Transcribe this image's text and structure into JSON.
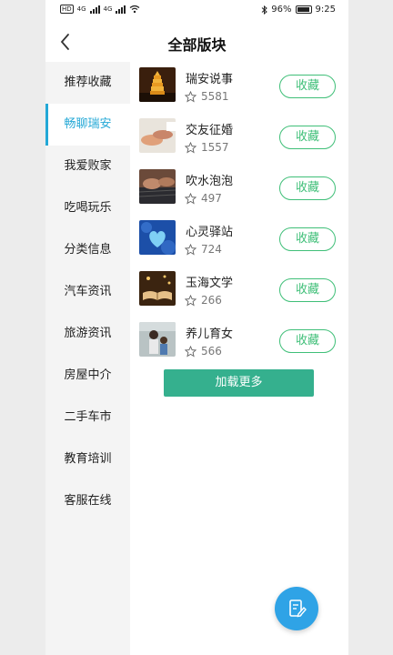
{
  "status": {
    "sim": "HD",
    "net1": "4G",
    "net2": "4G",
    "battery": "96%",
    "time": "9:25"
  },
  "header": {
    "title": "全部版块"
  },
  "sidebar": {
    "items": [
      {
        "label": "推荐收藏"
      },
      {
        "label": "畅聊瑞安",
        "active": true
      },
      {
        "label": "我爱败家"
      },
      {
        "label": "吃喝玩乐"
      },
      {
        "label": "分类信息"
      },
      {
        "label": "汽车资讯"
      },
      {
        "label": "旅游资讯"
      },
      {
        "label": "房屋中介"
      },
      {
        "label": "二手车市"
      },
      {
        "label": "教育培训"
      },
      {
        "label": "客服在线"
      }
    ]
  },
  "boards": [
    {
      "name": "瑞安说事",
      "count": "5581",
      "button": "收藏",
      "thumb": "pagoda-night"
    },
    {
      "name": "交友征婚",
      "count": "1557",
      "button": "收藏",
      "thumb": "hands"
    },
    {
      "name": "吹水泡泡",
      "count": "497",
      "button": "收藏",
      "thumb": "keyboard"
    },
    {
      "name": "心灵驿站",
      "count": "724",
      "button": "收藏",
      "thumb": "blue-heart"
    },
    {
      "name": "玉海文学",
      "count": "266",
      "button": "收藏",
      "thumb": "open-book"
    },
    {
      "name": "养儿育女",
      "count": "566",
      "button": "收藏",
      "thumb": "parent-child"
    }
  ],
  "load_more": "加载更多",
  "colors": {
    "accent_blue": "#23a8d6",
    "green": "#3fbf78",
    "load_more_bg": "#35b08e",
    "fab_bg": "#2fa3e6"
  },
  "icons": {
    "back": "chevron-left-icon",
    "star": "star-outline-icon",
    "fab": "edit-note-icon"
  }
}
